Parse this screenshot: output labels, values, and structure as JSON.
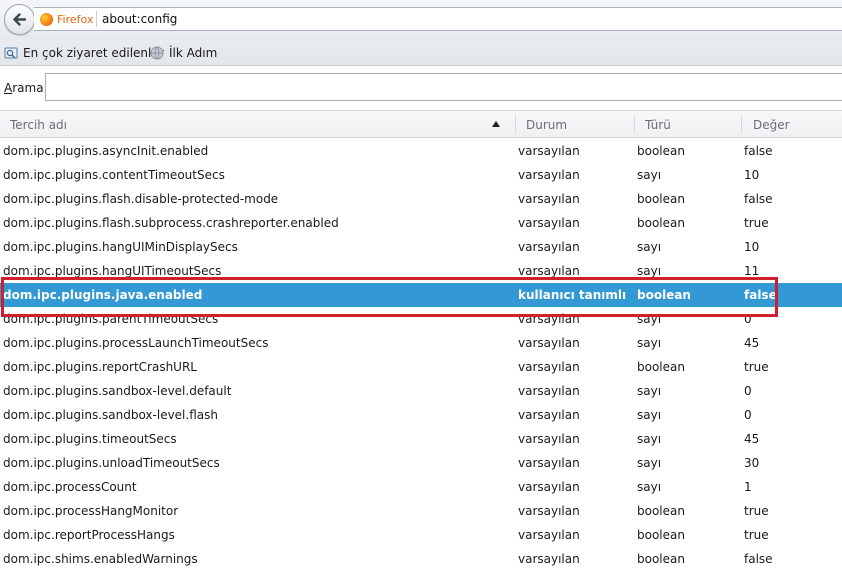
{
  "navbar": {
    "identity_label": "Firefox",
    "url": "about:config"
  },
  "bookmarks": [
    {
      "label": "En çok ziyaret edilenler",
      "icon": "bookmarks-folder-icon"
    },
    {
      "label": "İlk Adım",
      "icon": "globe-icon"
    }
  ],
  "search": {
    "label_accesskey": "A",
    "label_rest": "rama:",
    "value": ""
  },
  "table": {
    "columns": [
      "Tercih adı",
      "Durum",
      "Türü",
      "Değer"
    ],
    "sort_column": "Tercih adı",
    "selected_index": 6,
    "rows": [
      {
        "name": "dom.ipc.plugins.asyncInit.enabled",
        "status": "varsayılan",
        "type": "boolean",
        "value": "false"
      },
      {
        "name": "dom.ipc.plugins.contentTimeoutSecs",
        "status": "varsayılan",
        "type": "sayı",
        "value": "10"
      },
      {
        "name": "dom.ipc.plugins.flash.disable-protected-mode",
        "status": "varsayılan",
        "type": "boolean",
        "value": "false"
      },
      {
        "name": "dom.ipc.plugins.flash.subprocess.crashreporter.enabled",
        "status": "varsayılan",
        "type": "boolean",
        "value": "true"
      },
      {
        "name": "dom.ipc.plugins.hangUIMinDisplaySecs",
        "status": "varsayılan",
        "type": "sayı",
        "value": "10"
      },
      {
        "name": "dom.ipc.plugins.hangUITimeoutSecs",
        "status": "varsayılan",
        "type": "sayı",
        "value": "11"
      },
      {
        "name": "dom.ipc.plugins.java.enabled",
        "status": "kullanıcı tanımlı",
        "type": "boolean",
        "value": "false"
      },
      {
        "name": "dom.ipc.plugins.parentTimeoutSecs",
        "status": "varsayılan",
        "type": "sayı",
        "value": "0"
      },
      {
        "name": "dom.ipc.plugins.processLaunchTimeoutSecs",
        "status": "varsayılan",
        "type": "sayı",
        "value": "45"
      },
      {
        "name": "dom.ipc.plugins.reportCrashURL",
        "status": "varsayılan",
        "type": "boolean",
        "value": "true"
      },
      {
        "name": "dom.ipc.plugins.sandbox-level.default",
        "status": "varsayılan",
        "type": "sayı",
        "value": "0"
      },
      {
        "name": "dom.ipc.plugins.sandbox-level.flash",
        "status": "varsayılan",
        "type": "sayı",
        "value": "0"
      },
      {
        "name": "dom.ipc.plugins.timeoutSecs",
        "status": "varsayılan",
        "type": "sayı",
        "value": "45"
      },
      {
        "name": "dom.ipc.plugins.unloadTimeoutSecs",
        "status": "varsayılan",
        "type": "sayı",
        "value": "30"
      },
      {
        "name": "dom.ipc.processCount",
        "status": "varsayılan",
        "type": "sayı",
        "value": "1"
      },
      {
        "name": "dom.ipc.processHangMonitor",
        "status": "varsayılan",
        "type": "boolean",
        "value": "true"
      },
      {
        "name": "dom.ipc.reportProcessHangs",
        "status": "varsayılan",
        "type": "boolean",
        "value": "true"
      },
      {
        "name": "dom.ipc.shims.enabledWarnings",
        "status": "varsayılan",
        "type": "boolean",
        "value": "false"
      }
    ]
  },
  "colors": {
    "selection": "#3399d5",
    "annotation_box": "#d0202e",
    "identity": "#e2680f"
  }
}
